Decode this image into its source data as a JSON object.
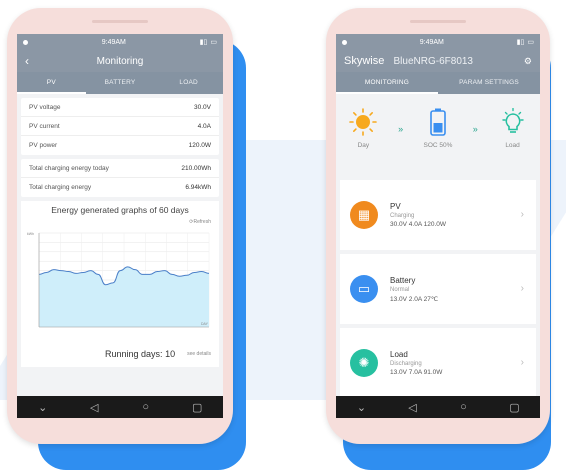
{
  "left_phone": {
    "status": {
      "time": "9:49AM"
    },
    "header": {
      "title": "Monitoring",
      "back_icon": "back-arrow-icon"
    },
    "tabs": [
      {
        "label": "PV",
        "active": true
      },
      {
        "label": "BATTERY",
        "active": false
      },
      {
        "label": "LOAD",
        "active": false
      }
    ],
    "pv_rows": [
      {
        "label": "PV voltage",
        "value": "30.0V"
      },
      {
        "label": "PV current",
        "value": "4.0A"
      },
      {
        "label": "PV power",
        "value": "120.0W"
      }
    ],
    "energy_rows": [
      {
        "label": "Total charging energy today",
        "value": "210.00Wh"
      },
      {
        "label": "Total charging energy",
        "value": "6.94kWh"
      }
    ],
    "graph": {
      "title": "Energy generated graphs of 60 days",
      "refresh": "⟳Refresh",
      "unit": "kWh",
      "x_unit": "DAY"
    },
    "running": {
      "label": "Running days:",
      "value": "10",
      "details": "see details"
    },
    "nav_icons": [
      "chevron-down-icon",
      "back-triangle-icon",
      "home-circle-icon",
      "recents-square-icon"
    ]
  },
  "right_phone": {
    "status": {
      "time": "9:49AM"
    },
    "header": {
      "app_name": "Skywise",
      "device": "BlueNRG-6F8013"
    },
    "tabs": [
      {
        "label": "MONITORING",
        "active": true
      },
      {
        "label": "PARAM SETTINGS",
        "active": false
      }
    ],
    "flow": [
      {
        "label": "Day",
        "icon": "sun-icon"
      },
      {
        "label": "SOC 50%",
        "icon": "battery-icon"
      },
      {
        "label": "Load",
        "icon": "bulb-icon"
      }
    ],
    "items": [
      {
        "title": "PV",
        "status": "Charging",
        "values": "30.0V  4.0A  120.0W",
        "icon": "solar-panel-icon",
        "color": "#f08a1e"
      },
      {
        "title": "Battery",
        "status": "Normal",
        "values": "13.0V  2.0A  27℃",
        "icon": "battery-icon",
        "color": "#3a8ff0"
      },
      {
        "title": "Load",
        "status": "Discharging",
        "values": "13.0V  7.0A  91.0W",
        "icon": "bulb-icon",
        "color": "#27c0a0"
      }
    ]
  },
  "colors": {
    "header": "#8b97a5",
    "accent_blue": "#2f8ef0",
    "phone_frame": "#f6dedb"
  },
  "chart_data": {
    "type": "area",
    "x": [
      1,
      2,
      3,
      4,
      5,
      6,
      7,
      8,
      9,
      10,
      11,
      12,
      13,
      14,
      15,
      16,
      17,
      18,
      19,
      20,
      21,
      22,
      23,
      24
    ],
    "y": [
      560,
      580,
      610,
      600,
      590,
      570,
      580,
      600,
      560,
      450,
      470,
      600,
      640,
      610,
      560,
      560,
      590,
      600,
      560,
      540,
      550,
      580,
      590,
      570
    ],
    "ylim": [
      0,
      1000
    ],
    "xlabel": "DAY",
    "ylabel": "kWh",
    "grid": true,
    "fill_color": "#cfeefa",
    "line_color": "#4a7fc8"
  }
}
